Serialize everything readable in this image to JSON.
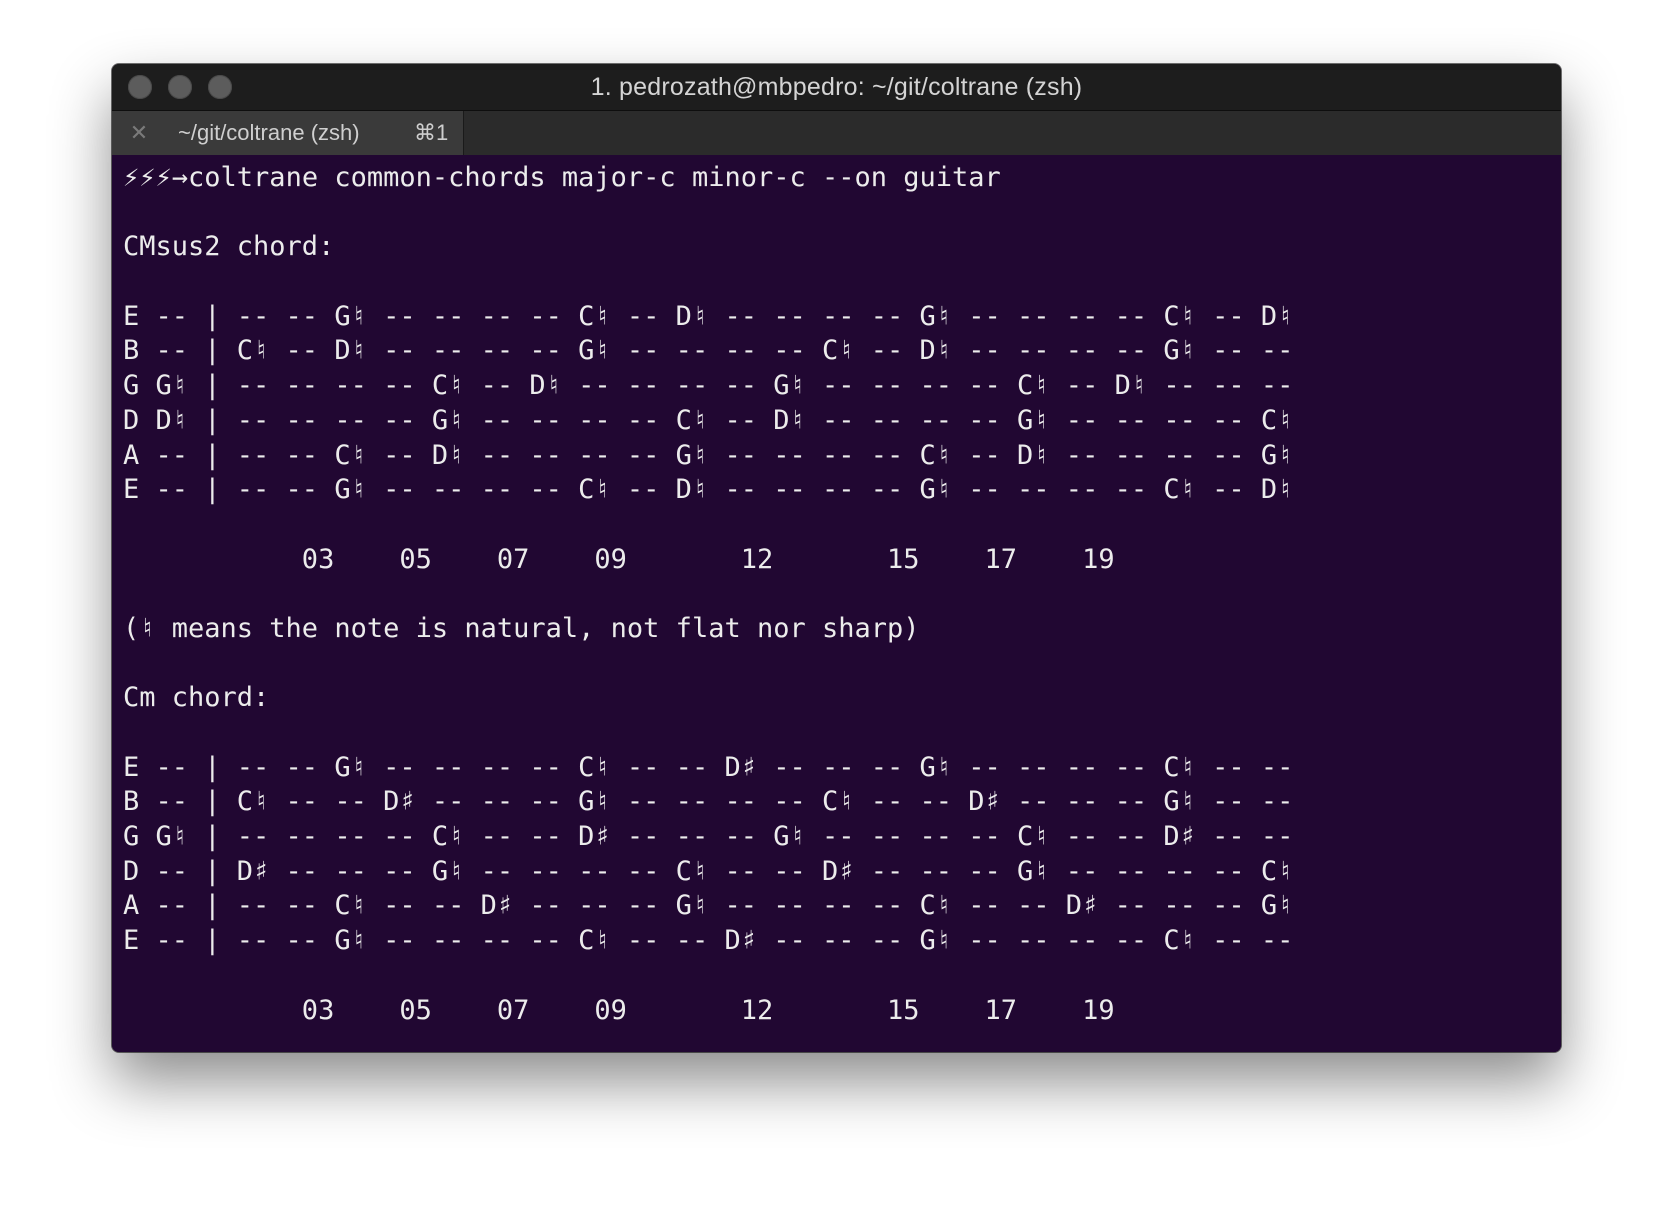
{
  "window": {
    "title": "1. pedrozath@mbpedro: ~/git/coltrane (zsh)"
  },
  "tab": {
    "label": "~/git/coltrane (zsh)",
    "shortcut": "⌘1"
  },
  "terminal": {
    "prompt": "⚡⚡⚡→",
    "command": "coltrane common-chords major-c minor-c --on guitar",
    "chord1": {
      "heading": "CMsus2 chord:",
      "strings": [
        "E -- | -- -- G♮ -- -- -- -- C♮ -- D♮ -- -- -- -- G♮ -- -- -- -- C♮ -- D♮",
        "B -- | C♮ -- D♮ -- -- -- -- G♮ -- -- -- -- C♮ -- D♮ -- -- -- -- G♮ -- --",
        "G G♮ | -- -- -- -- C♮ -- D♮ -- -- -- -- G♮ -- -- -- -- C♮ -- D♮ -- -- --",
        "D D♮ | -- -- -- -- G♮ -- -- -- -- C♮ -- D♮ -- -- -- -- G♮ -- -- -- -- C♮",
        "A -- | -- -- C♮ -- D♮ -- -- -- -- G♮ -- -- -- -- C♮ -- D♮ -- -- -- -- G♮",
        "E -- | -- -- G♮ -- -- -- -- C♮ -- D♮ -- -- -- -- G♮ -- -- -- -- C♮ -- D♮"
      ],
      "frets": "           03    05    07    09       12       15    17    19"
    },
    "note": "(♮ means the note is natural, not flat nor sharp)",
    "chord2": {
      "heading": "Cm chord:",
      "strings": [
        "E -- | -- -- G♮ -- -- -- -- C♮ -- -- D♯ -- -- -- G♮ -- -- -- -- C♮ -- --",
        "B -- | C♮ -- -- D♯ -- -- -- G♮ -- -- -- -- C♮ -- -- D♯ -- -- -- G♮ -- --",
        "G G♮ | -- -- -- -- C♮ -- -- D♯ -- -- -- G♮ -- -- -- -- C♮ -- -- D♯ -- --",
        "D -- | D♯ -- -- -- G♮ -- -- -- -- C♮ -- -- D♯ -- -- -- G♮ -- -- -- -- C♮",
        "A -- | -- -- C♮ -- -- D♯ -- -- -- G♮ -- -- -- -- C♮ -- -- D♯ -- -- -- G♮",
        "E -- | -- -- G♮ -- -- -- -- C♮ -- -- D♯ -- -- -- G♮ -- -- -- -- C♮ -- --"
      ],
      "frets": "           03    05    07    09       12       15    17    19"
    }
  },
  "icons": {
    "close": "close-icon",
    "traffic_lights": [
      "close-light",
      "minimize-light",
      "zoom-light"
    ]
  },
  "colors": {
    "terminal_bg": "#210732",
    "terminal_fg": "#ececec",
    "titlebar_bg": "#1d1d1d",
    "tab_bg": "#3a3a3a"
  }
}
